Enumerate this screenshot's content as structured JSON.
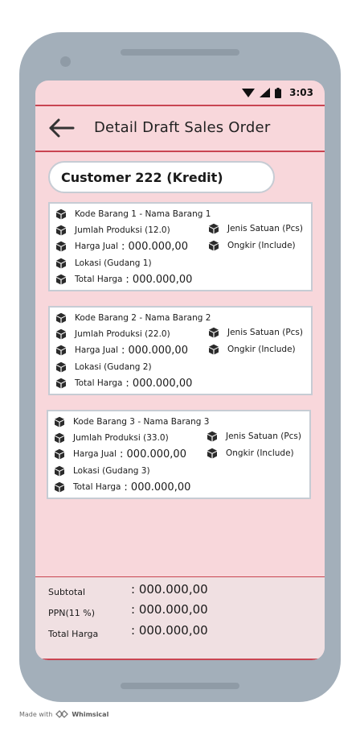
{
  "status_bar": {
    "time": "3:03"
  },
  "header": {
    "title": "Detail Draft Sales Order"
  },
  "customer": {
    "label": "Customer 222 (Kredit)"
  },
  "items": [
    {
      "kode": "Kode Barang 1 - Nama Barang 1",
      "jumlah": "Jumlah Produksi (12.0)",
      "satuan": "Jenis Satuan (Pcs)",
      "harga_label": "Harga Jual",
      "harga_value": ": 000.000,00",
      "ongkir": "Ongkir (Include)",
      "lokasi": "Lokasi (Gudang 1)",
      "total_label": "Total Harga",
      "total_value": ": 000.000,00"
    },
    {
      "kode": "Kode Barang 2 - Nama Barang 2",
      "jumlah": "Jumlah Produksi (22.0)",
      "satuan": "Jenis Satuan (Pcs)",
      "harga_label": "Harga Jual",
      "harga_value": ": 000.000,00",
      "ongkir": "Ongkir (Include)",
      "lokasi": "Lokasi (Gudang 2)",
      "total_label": "Total Harga",
      "total_value": ": 000.000,00"
    },
    {
      "kode": "Kode Barang 3 - Nama Barang 3",
      "jumlah": "Jumlah Produksi (33.0)",
      "satuan": "Jenis Satuan (Pcs)",
      "harga_label": "Harga Jual",
      "harga_value": ": 000.000,00",
      "ongkir": "Ongkir (Include)",
      "lokasi": "Lokasi (Gudang 3)",
      "total_label": "Total Harga",
      "total_value": ": 000.000,00"
    }
  ],
  "summary": {
    "subtotal_label": "Subtotal",
    "subtotal_value": ": 000.000,00",
    "ppn_label": "PPN(11 %)",
    "ppn_value": ": 000.000,00",
    "total_label": "Total Harga",
    "total_value": ": 000.000,00"
  },
  "watermark": {
    "prefix": "Made with",
    "brand": "Whimsical"
  },
  "icons": {
    "item": "cube-icon",
    "back": "arrow-left-icon"
  },
  "colors": {
    "screen_bg": "#f8d7db",
    "accent_line": "#c94552",
    "device": "#a3afba"
  }
}
